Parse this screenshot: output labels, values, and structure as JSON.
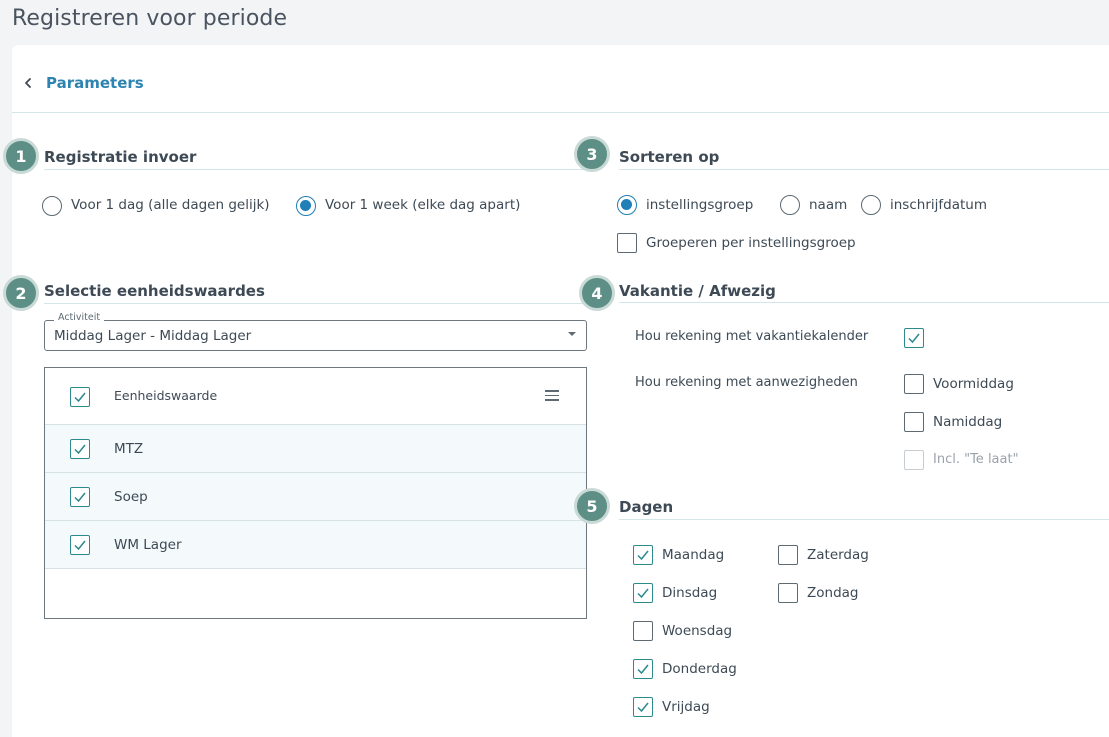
{
  "page_title": "Registreren voor periode",
  "back_label": "Parameters",
  "sections": {
    "s1": {
      "num": "1",
      "title": "Registratie invoer"
    },
    "s2": {
      "num": "2",
      "title": "Selectie eenheidswaardes"
    },
    "s3": {
      "num": "3",
      "title": "Sorteren op"
    },
    "s4": {
      "num": "4",
      "title": "Vakantie / Afwezig"
    },
    "s5": {
      "num": "5",
      "title": "Dagen"
    }
  },
  "registratie": {
    "options": [
      {
        "label": "Voor 1 dag (alle dagen gelijk)",
        "selected": false
      },
      {
        "label": "Voor 1 week (elke dag apart)",
        "selected": true
      }
    ]
  },
  "sorteren": {
    "options": [
      {
        "label": "instellingsgroep",
        "selected": true
      },
      {
        "label": "naam",
        "selected": false
      },
      {
        "label": "inschrijfdatum",
        "selected": false
      }
    ],
    "group_label": "Groeperen per instellingsgroep",
    "group_checked": false
  },
  "activiteit": {
    "legend": "Activiteit",
    "value": "Middag Lager - Middag Lager"
  },
  "grid": {
    "header": "Eenheidswaarde",
    "rows": [
      {
        "label": "MTZ",
        "checked": true
      },
      {
        "label": "Soep",
        "checked": true
      },
      {
        "label": "WM Lager",
        "checked": true
      }
    ]
  },
  "vakantie": {
    "kalender_label": "Hou rekening met vakantiekalender",
    "kalender_checked": true,
    "aanwezig_label": "Hou rekening met aanwezigheden",
    "voormiddag": "Voormiddag",
    "namiddag": "Namiddag",
    "te_laat": "Incl. \"Te laat\""
  },
  "dagen": {
    "maandag": "Maandag",
    "dinsdag": "Dinsdag",
    "woensdag": "Woensdag",
    "donderdag": "Donderdag",
    "vrijdag": "Vrijdag",
    "zaterdag": "Zaterdag",
    "zondag": "Zondag"
  },
  "colors": {
    "accent": "#1f7fb6",
    "badge": "#5d8f86",
    "check": "#2c8a8c"
  }
}
